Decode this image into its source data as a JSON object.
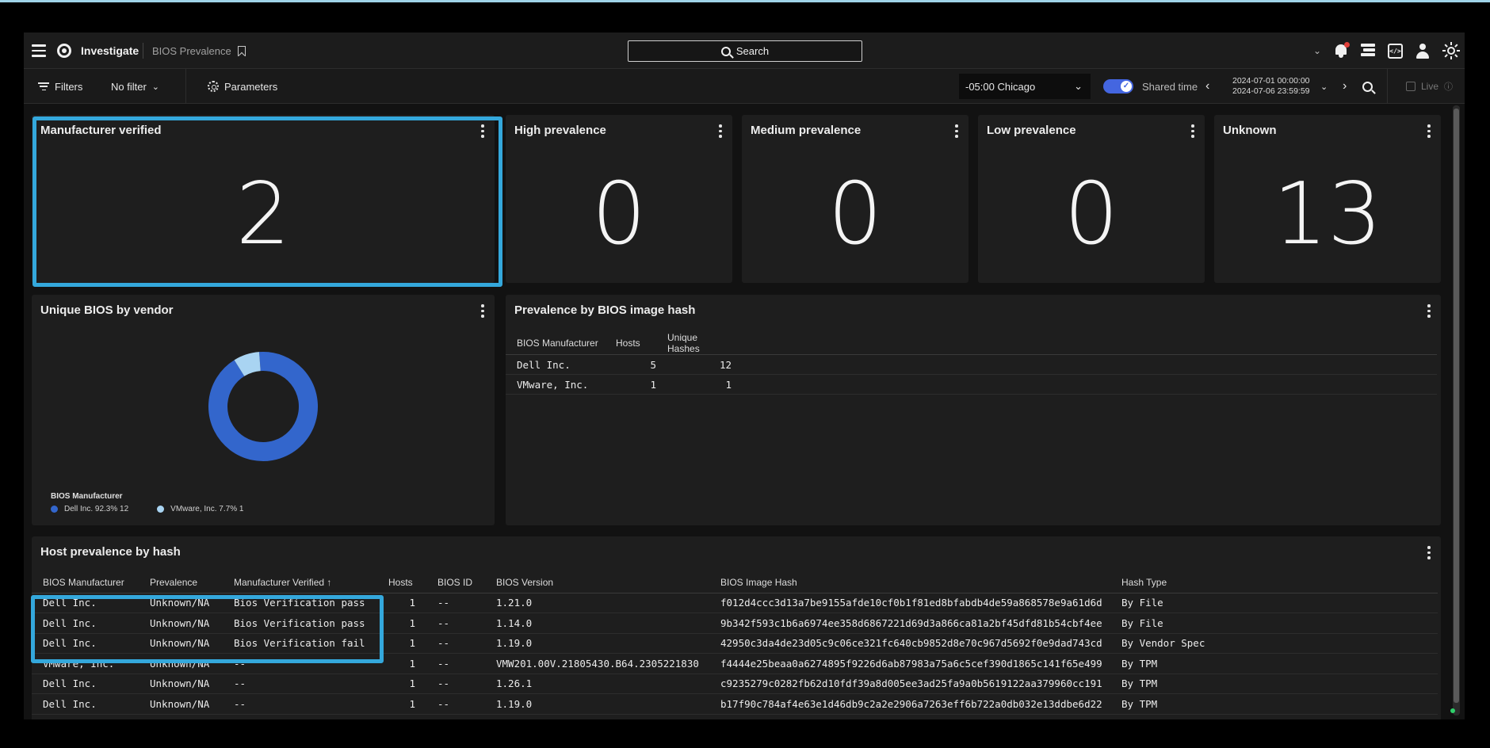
{
  "header": {
    "app_name": "Investigate",
    "breadcrumb": "BIOS Prevalence",
    "search_label": "Search"
  },
  "toolbar": {
    "filters_label": "Filters",
    "filter_value": "No filter",
    "parameters_label": "Parameters",
    "timezone": "-05:00 Chicago",
    "shared_time_label": "Shared time",
    "start_time": "2024-07-01 00:00:00",
    "end_time": "2024-07-06 23:59:59",
    "live_label": "Live"
  },
  "stat_cards": [
    {
      "title": "Manufacturer verified",
      "value": "2"
    },
    {
      "title": "High prevalence",
      "value": "0"
    },
    {
      "title": "Medium prevalence",
      "value": "0"
    },
    {
      "title": "Low prevalence",
      "value": "0"
    },
    {
      "title": "Unknown",
      "value": "13"
    }
  ],
  "vendor_panel": {
    "title": "Unique BIOS by vendor",
    "legend_title": "BIOS Manufacturer",
    "legend": [
      {
        "label": "Dell Inc. 92.3% 12",
        "color": "#3366cc"
      },
      {
        "label": "VMware, Inc. 7.7% 1",
        "color": "#a9d4f2"
      }
    ]
  },
  "chart_data": {
    "type": "pie",
    "categories": [
      "Dell Inc.",
      "VMware, Inc."
    ],
    "values": [
      12,
      1
    ],
    "percentages": [
      92.3,
      7.7
    ],
    "colors": [
      "#3366cc",
      "#a9d4f2"
    ],
    "donut": true
  },
  "hash_panel": {
    "title": "Prevalence by BIOS image hash",
    "columns": [
      "BIOS Manufacturer",
      "Hosts",
      "Unique Hashes"
    ],
    "rows": [
      [
        "Dell Inc.",
        "5",
        "12"
      ],
      [
        "VMware, Inc.",
        "1",
        "1"
      ]
    ]
  },
  "host_panel": {
    "title": "Host prevalence by hash",
    "columns": [
      "BIOS Manufacturer",
      "Prevalence",
      "Manufacturer Verified",
      "Hosts",
      "BIOS ID",
      "BIOS Version",
      "BIOS Image Hash",
      "Hash Type"
    ],
    "sort_indicator": "↑",
    "rows": [
      [
        "Dell Inc.",
        "Unknown/NA",
        "Bios Verification pass",
        "1",
        "--",
        "1.21.0",
        "f012d4ccc3d13a7be9155afde10cf0b1f81ed8bfabdb4de59a868578e9a61d6d",
        "By File"
      ],
      [
        "Dell Inc.",
        "Unknown/NA",
        "Bios Verification pass",
        "1",
        "--",
        "1.14.0",
        "9b342f593c1b6a6974ee358d6867221d69d3a866ca81a2bf45dfd81b54cbf4ee",
        "By File"
      ],
      [
        "Dell Inc.",
        "Unknown/NA",
        "Bios Verification fail",
        "1",
        "--",
        "1.19.0",
        "42950c3da4de23d05c9c06ce321fc640cb9852d8e70c967d5692f0e9dad743cd",
        "By Vendor Spec"
      ],
      [
        "VMware, Inc.",
        "Unknown/NA",
        "--",
        "1",
        "--",
        "VMW201.00V.21805430.B64.2305221830",
        "f4444e25beaa0a6274895f9226d6ab87983a75a6c5cef390d1865c141f65e499",
        "By TPM"
      ],
      [
        "Dell Inc.",
        "Unknown/NA",
        "--",
        "1",
        "--",
        "1.26.1",
        "c9235279c0282fb62d10fdf39a8d005ee3ad25fa9a0b5619122aa379960cc191",
        "By TPM"
      ],
      [
        "Dell Inc.",
        "Unknown/NA",
        "--",
        "1",
        "--",
        "1.19.0",
        "b17f90c784af4e63e1d46db9c2a2e2906a7263eff6b722a0db032e13ddbe6d22",
        "By TPM"
      ]
    ]
  }
}
